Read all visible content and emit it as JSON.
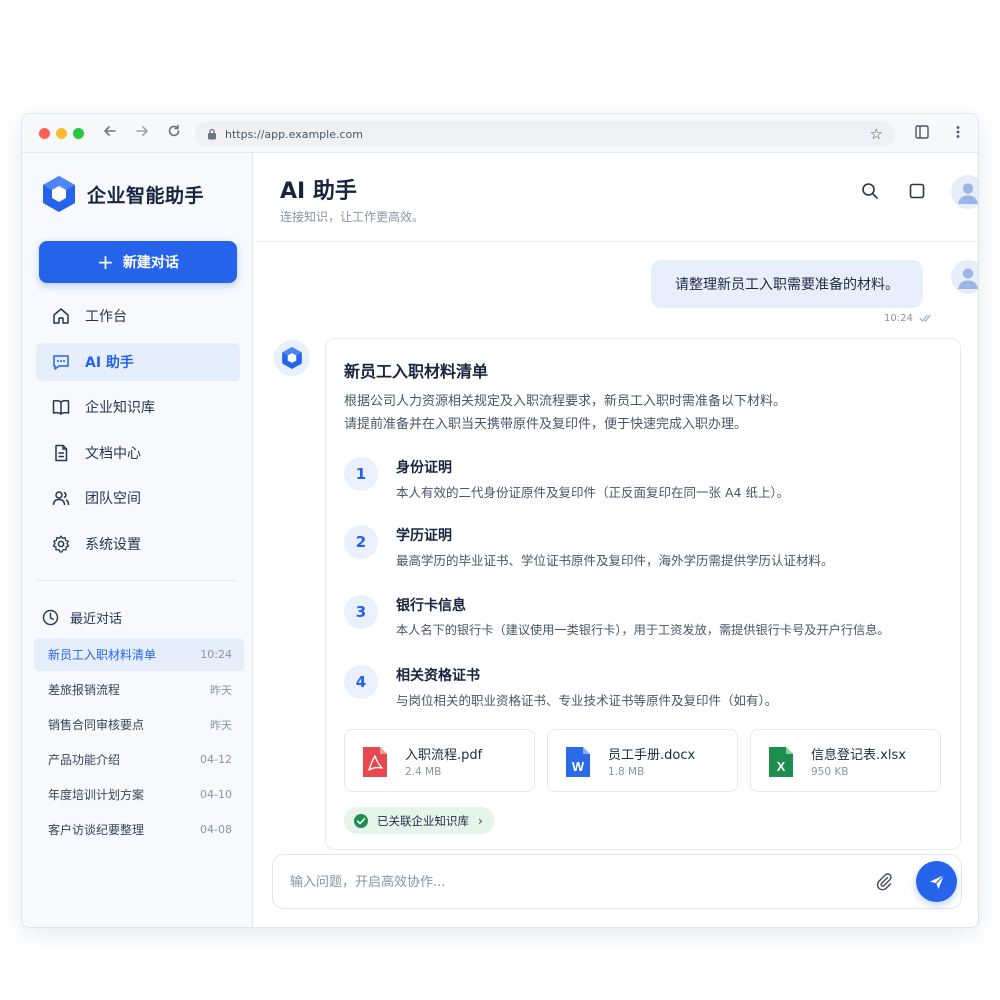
{
  "browser": {
    "url": "https://app.example.com"
  },
  "sidebar": {
    "brand": "企业智能助手",
    "new_chat_label": "新建对话",
    "menu": [
      {
        "label": "工作台",
        "icon": "home-icon"
      },
      {
        "label": "AI 助手",
        "icon": "chat-icon"
      },
      {
        "label": "企业知识库",
        "icon": "book-icon"
      },
      {
        "label": "文档中心",
        "icon": "document-icon"
      },
      {
        "label": "团队空间",
        "icon": "team-icon"
      },
      {
        "label": "系统设置",
        "icon": "gear-icon"
      }
    ],
    "recent_heading": "最近对话",
    "recent": [
      {
        "title": "新员工入职材料清单",
        "time": "10:24"
      },
      {
        "title": "差旅报销流程",
        "time": "昨天"
      },
      {
        "title": "销售合同审核要点",
        "time": "昨天"
      },
      {
        "title": "产品功能介绍",
        "time": "04-12"
      },
      {
        "title": "年度培训计划方案",
        "time": "04-10"
      },
      {
        "title": "客户访谈纪要整理",
        "time": "04-08"
      }
    ]
  },
  "header": {
    "title": "AI 助手",
    "subtitle": "连接知识，让工作更高效。"
  },
  "chat": {
    "user_message": "请整理新员工入职需要准备的材料。",
    "user_time": "10:24",
    "answer": {
      "title": "新员工入职材料清单",
      "intro_line1": "根据公司人力资源相关规定及入职流程要求，新员工入职时需准备以下材料。",
      "intro_line2": "请提前准备并在入职当天携带原件及复印件，便于快速完成入职办理。",
      "steps": [
        {
          "num": "1",
          "title": "身份证明",
          "desc": "本人有效的二代身份证原件及复印件（正反面复印在同一张 A4 纸上）。"
        },
        {
          "num": "2",
          "title": "学历证明",
          "desc": "最高学历的毕业证书、学位证书原件及复印件，海外学历需提供学历认证材料。"
        },
        {
          "num": "3",
          "title": "银行卡信息",
          "desc": "本人名下的银行卡（建议使用一类银行卡），用于工资发放，需提供银行卡号及开户行信息。"
        },
        {
          "num": "4",
          "title": "相关资格证书",
          "desc": "与岗位相关的职业资格证书、专业技术证书等原件及复印件（如有）。"
        }
      ],
      "files": [
        {
          "name": "入职流程.pdf",
          "size": "2.4 MB",
          "icon": "pdf-icon",
          "color": "#e5484d"
        },
        {
          "name": "员工手册.docx",
          "size": "1.8 MB",
          "icon": "word-icon",
          "color": "#2b6be8"
        },
        {
          "name": "信息登记表.xlsx",
          "size": "950 KB",
          "icon": "excel-icon",
          "color": "#1e8e4e"
        }
      ],
      "kb_chip": "已关联企业知识库"
    }
  },
  "composer": {
    "placeholder": "输入问题，开启高效协作..."
  },
  "colors": {
    "accent": "#2563eb",
    "success": "#1e8e4e"
  }
}
